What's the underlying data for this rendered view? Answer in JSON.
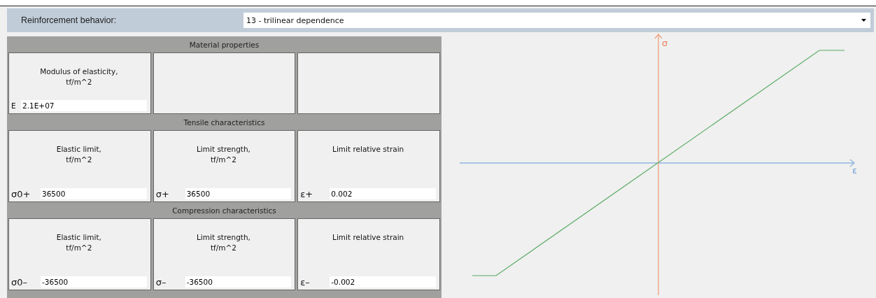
{
  "behavior": {
    "label": "Reinforcement behavior:",
    "value": "13 - trilinear dependence"
  },
  "sections": [
    {
      "title": "Material properties",
      "cells": [
        {
          "kind": "field",
          "label": "Modulus of elasticity,\ntf/m^2",
          "symbol": "E",
          "value": "2.1E+07"
        },
        {
          "kind": "empty"
        },
        {
          "kind": "empty"
        }
      ]
    },
    {
      "title": "Tensile characteristics",
      "cells": [
        {
          "kind": "field",
          "label": "Elastic limit,\ntf/m^2",
          "symbol": "σ0+",
          "value": "36500"
        },
        {
          "kind": "field",
          "label": "Limit strength,\ntf/m^2",
          "symbol": "σ+",
          "value": "36500"
        },
        {
          "kind": "field",
          "label": "Limit relative strain",
          "symbol": "ε+",
          "value": "0.002"
        }
      ]
    },
    {
      "title": "Compression characteristics",
      "cells": [
        {
          "kind": "field",
          "label": "Elastic limit,\ntf/m^2",
          "symbol": "σ0–",
          "value": "-36500"
        },
        {
          "kind": "field",
          "label": "Limit strength,\ntf/m^2",
          "symbol": "σ–",
          "value": "-36500"
        },
        {
          "kind": "field",
          "label": "Limit relative strain",
          "symbol": "ε–",
          "value": "-0.002"
        }
      ]
    }
  ],
  "diagram": {
    "y_axis_label": "σ",
    "x_axis_label": "ε"
  }
}
